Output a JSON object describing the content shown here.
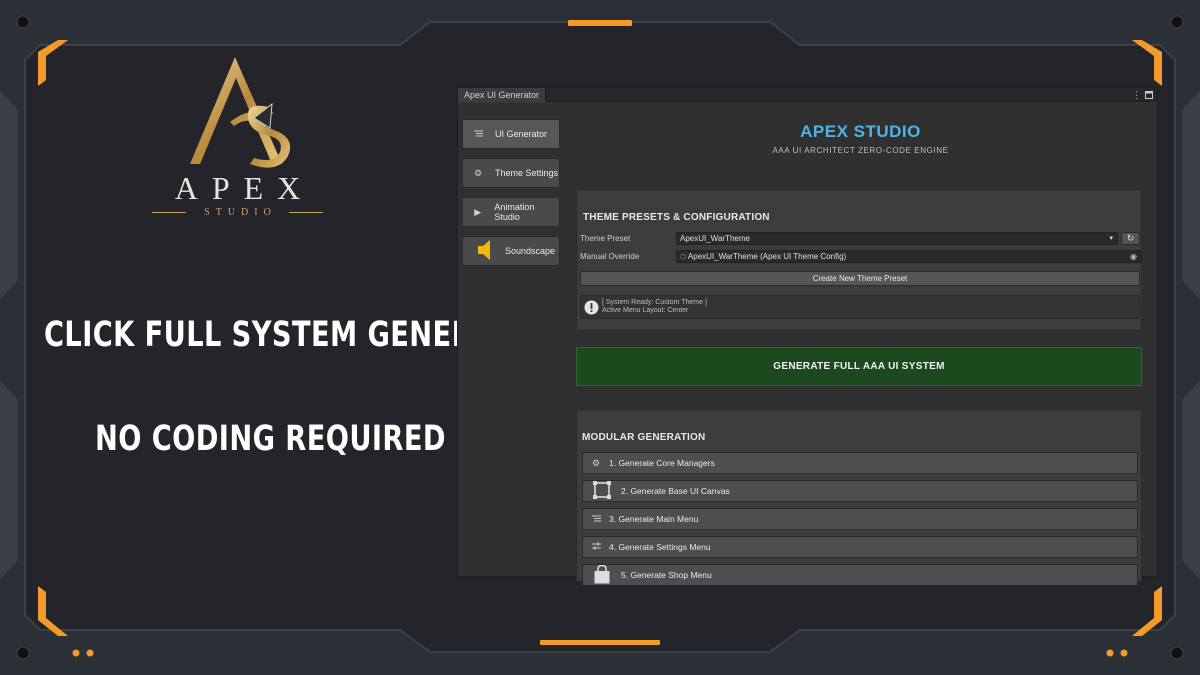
{
  "promo": {
    "headline_1": "CLICK FULL SYSTEM GENERATION",
    "headline_2": "NO CODING REQUIRED"
  },
  "logo": {
    "word": "APEX",
    "sub": "STUDIO",
    "colors": {
      "gold": "#c9a45c",
      "silver": "#e8e4da"
    }
  },
  "window": {
    "tab_title": "Apex UI Generator",
    "menu_icon": "kebab-menu-icon",
    "maximize_icon": "maximize-icon"
  },
  "sidebar": {
    "items": [
      {
        "label": "UI Generator",
        "icon": "list-icon"
      },
      {
        "label": "Theme Settings",
        "icon": "gear-icon"
      },
      {
        "label": "Animation Studio",
        "icon": "play-icon"
      },
      {
        "label": "Soundscape",
        "icon": "speaker-icon"
      }
    ]
  },
  "brand": {
    "title": "APEX STUDIO",
    "subtitle": "AAA UI ARCHITECT  ZERO-CODE ENGINE"
  },
  "theme_panel": {
    "title": "THEME PRESETS & CONFIGURATION",
    "preset_label": "Theme Preset",
    "preset_value": "ApexUI_WarTheme",
    "override_label": "Manual Override",
    "override_value": "ApexUI_WarTheme (Apex UI Theme Config)",
    "create_button": "Create New Theme Preset",
    "status_line_1": "[ System Ready: Custom Theme ]",
    "status_line_2": "Active Menu Layout: Center"
  },
  "generate_button": "GENERATE FULL AAA UI SYSTEM",
  "modular": {
    "title": "MODULAR GENERATION",
    "buttons": [
      {
        "label": "1. Generate Core Managers",
        "icon": "gear-icon"
      },
      {
        "label": "2. Generate Base UI Canvas",
        "icon": "canvas-frame-icon"
      },
      {
        "label": "3. Generate Main Menu",
        "icon": "list-icon"
      },
      {
        "label": "4. Generate Settings Menu",
        "icon": "sliders-icon"
      },
      {
        "label": "5. Generate Shop Menu",
        "icon": "shopping-bag-icon"
      }
    ]
  },
  "colors": {
    "accent_orange": "#f39a2b",
    "brand_blue": "#4fb3e8",
    "generate_green": "#1b4a1f"
  }
}
